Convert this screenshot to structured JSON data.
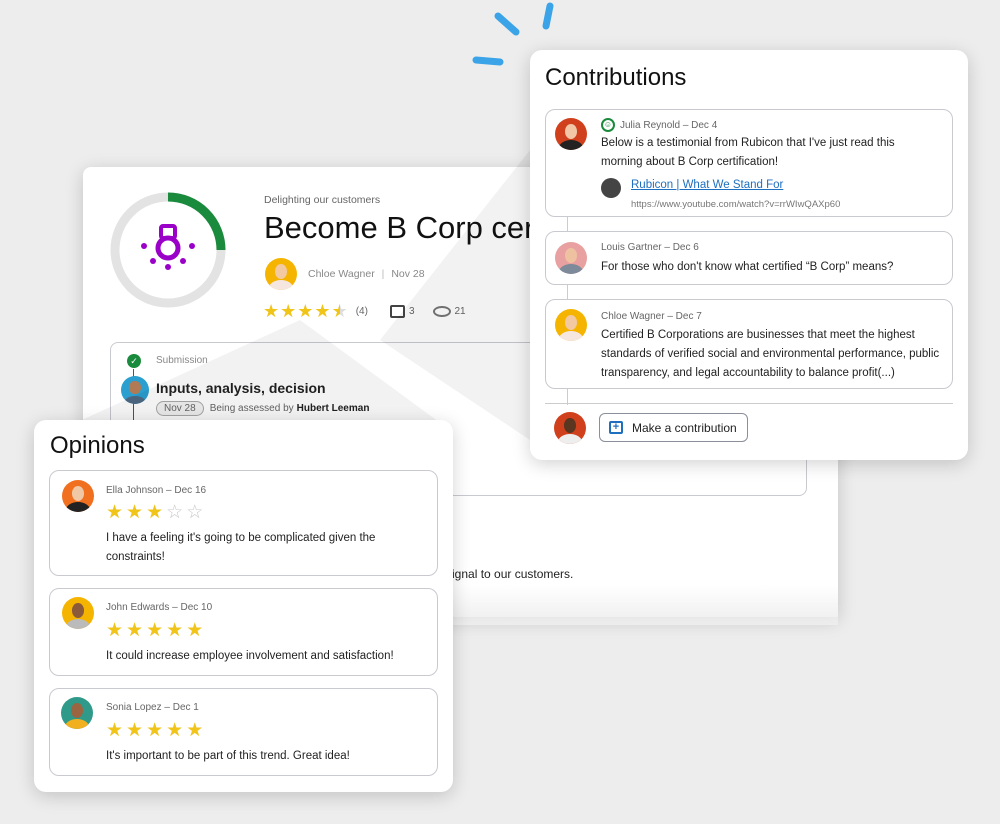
{
  "colors": {
    "accent_purple": "#9b00c9",
    "progress_green": "#1a8a3c",
    "star_yellow": "#f0c419",
    "link_blue": "#1f6fbf",
    "spark_blue": "#3ba3e8"
  },
  "idea": {
    "category": "Delighting our customers",
    "title": "Become B Corp cert",
    "author": "Chloe Wagner",
    "date": "Nov 28",
    "rating": 4.5,
    "rating_count": "(4)",
    "comments": "3",
    "views": "21",
    "progress": 0.25,
    "icon": "lightbulb-icon",
    "step": {
      "label": "Submission",
      "title": "Inputs, analysis, decision",
      "date": "Nov 28",
      "status_prefix": "Being assessed by",
      "assessor": "Hubert Leeman"
    },
    "description_fragment": "ignal to our customers."
  },
  "contributions": {
    "title": "Contributions",
    "items": [
      {
        "author": "Julia Reynold – Dec 4",
        "text": "Below is a testimonial from Rubicon that I've just read this morning about B Corp certification!",
        "link_title": "Rubicon | What We Stand For",
        "link_url": "https://www.youtube.com/watch?v=rrWIwQAXp60",
        "badge": "smiley-icon"
      },
      {
        "author": "Louis Gartner – Dec 6",
        "text": "For those who don't know what certified “B Corp” means?"
      },
      {
        "author": "Chloe Wagner – Dec 7",
        "text": "Certified B Corporations are businesses that meet the highest standards of verified social and environmental performance, public transparency, and legal accountability to balance profit(...)"
      }
    ],
    "button": "Make a contribution"
  },
  "opinions": {
    "title": "Opinions",
    "items": [
      {
        "author": "Ella Johnson – Dec 16",
        "rating": 3,
        "text": "I have a feeling it's going to be complicated given the constraints!"
      },
      {
        "author": "John Edwards – Dec 10",
        "rating": 5,
        "text": "It could increase employee involvement and satisfaction!"
      },
      {
        "author": "Sonia Lopez – Dec 1",
        "rating": 5,
        "text": "It's important to be part of this trend. Great idea!"
      }
    ]
  }
}
